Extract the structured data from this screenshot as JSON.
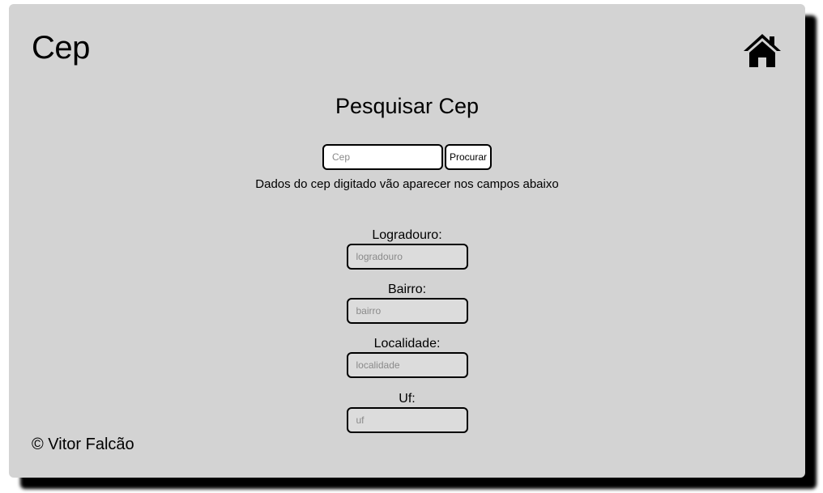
{
  "header": {
    "title": "Cep",
    "home_icon": "home-icon"
  },
  "search": {
    "title": "Pesquisar Cep",
    "input_placeholder": "Cep",
    "input_value": "",
    "button_label": "Procurar",
    "hint": "Dados do cep digitado vão aparecer nos campos abaixo"
  },
  "fields": [
    {
      "label": "Logradouro:",
      "placeholder": "logradouro",
      "value": ""
    },
    {
      "label": "Bairro:",
      "placeholder": "bairro",
      "value": ""
    },
    {
      "label": "Localidade:",
      "placeholder": "localidade",
      "value": ""
    },
    {
      "label": "Uf:",
      "placeholder": "uf",
      "value": ""
    }
  ],
  "footer": {
    "text": "© Vitor Falcão"
  },
  "colors": {
    "card_background": "#d3d3d3",
    "shadow": "#000000",
    "field_background": "#dcdcdc",
    "input_background": "#ffffff"
  }
}
